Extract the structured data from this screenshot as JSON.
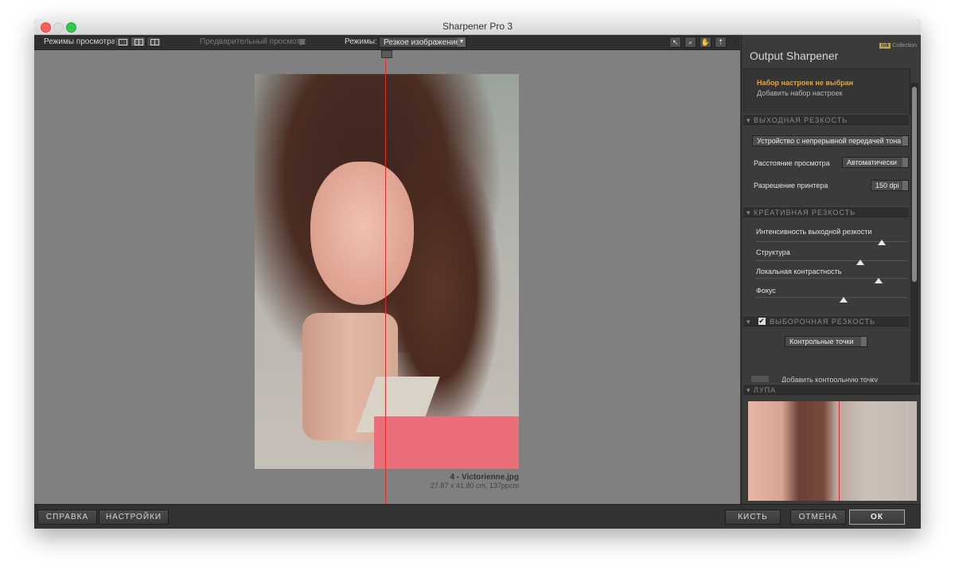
{
  "window": {
    "title": "Sharpener Pro 3"
  },
  "toolbar": {
    "view_modes_label": "Режимы просмотра:",
    "preview_label": "Предварительный просмотр:",
    "modes_label": "Режимы:",
    "mode_value": "Резкое изображение"
  },
  "image": {
    "filename": "4 - Victorienne.jpg",
    "dimensions": "27.87 x 41.80 cm, 137ppcm"
  },
  "panel": {
    "brand": "Collection",
    "brand_badge": "nik",
    "title": "Output Sharpener",
    "preset_none": "Набор настроек не выбран",
    "preset_add": "Добавить набор настроек",
    "output_section": "ВЫХОДНАЯ РЕЗКОСТЬ",
    "device_value": "Устройство с непрерывной передачей тона",
    "distance_label": "Расстояние просмотра",
    "distance_value": "Автоматически",
    "resolution_label": "Разрешение принтера",
    "resolution_value": "150 dpi",
    "creative_section": "КРЕАТИВНАЯ РЕЗКОСТЬ",
    "sliders": [
      {
        "label": "Интенсивность выходной резкости",
        "value": 0.83
      },
      {
        "label": "Структура",
        "value": 0.69
      },
      {
        "label": "Локальная контрастность",
        "value": 0.81
      },
      {
        "label": "Фокус",
        "value": 0.58
      }
    ],
    "selective_section": "ВЫБОРОЧНАЯ РЕЗКОСТЬ",
    "control_points_value": "Контрольные точки",
    "add_control_point": "Добавить контрольную точку",
    "loupe_section": "ЛУПА"
  },
  "bottom": {
    "help": "СПРАВКА",
    "settings": "НАСТРОЙКИ",
    "brush": "КИСТЬ",
    "cancel": "ОТМЕНА",
    "ok": "ОК"
  }
}
